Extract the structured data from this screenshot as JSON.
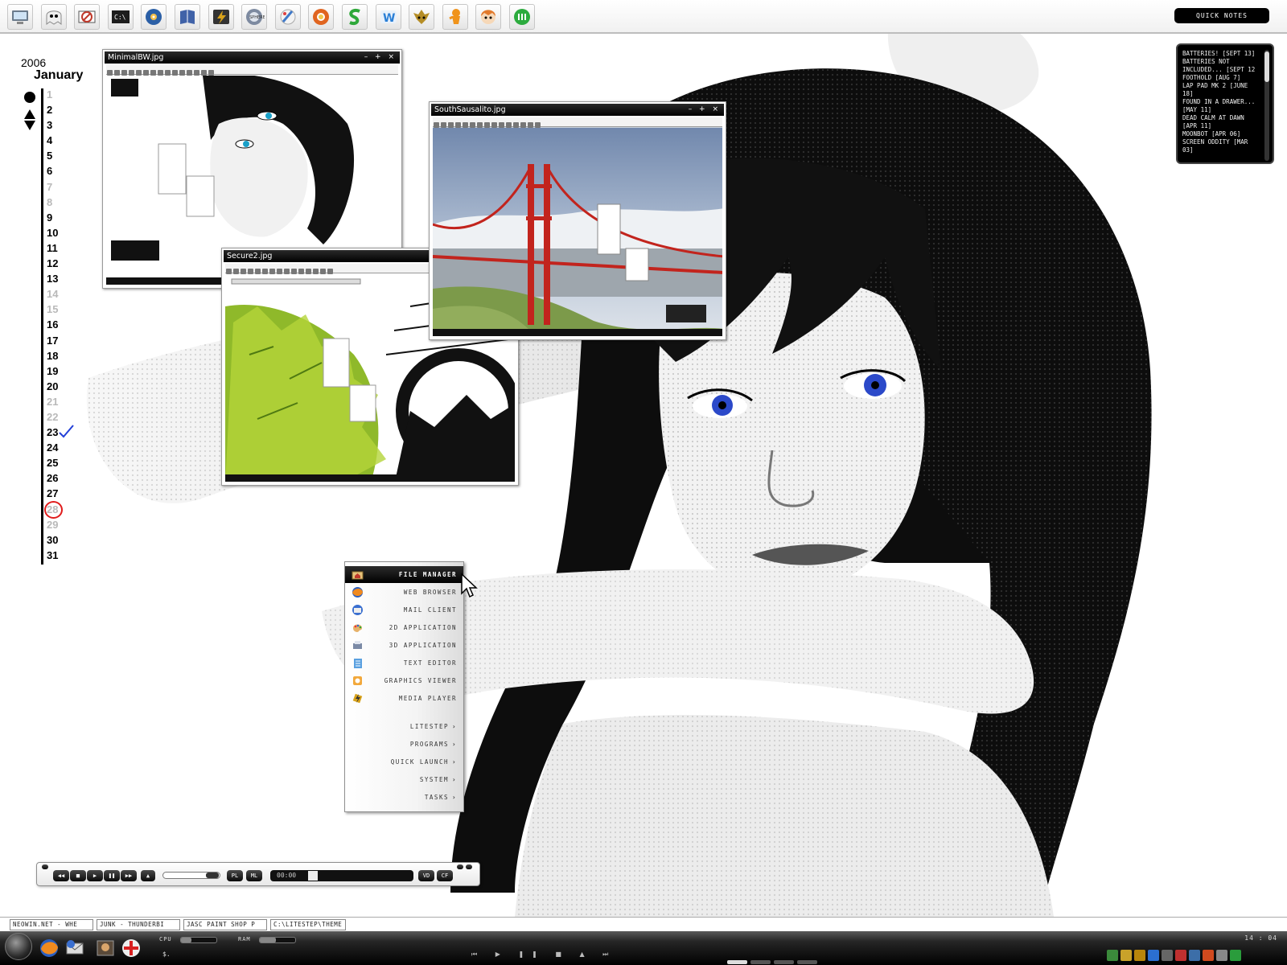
{
  "topbar": {
    "launch_icons": [
      {
        "icon": "my-computer-icon",
        "color": "#6b7b8c"
      },
      {
        "icon": "ghost-face-icon",
        "color": "#8a8a8a"
      },
      {
        "icon": "no-smoking-sign-icon",
        "color": "#c0392b"
      },
      {
        "icon": "command-prompt-icon",
        "color": "#1c1c1c"
      },
      {
        "icon": "media-disc-icon",
        "color": "#2b5fa6"
      },
      {
        "icon": "book-icon",
        "color": "#4062a8"
      },
      {
        "icon": "lightning-icon",
        "color": "#d8a21a"
      },
      {
        "icon": "chrome-sphere-icon",
        "color": "#7d8aa0"
      },
      {
        "icon": "paint-brush-icon",
        "color": "#3f79c9"
      },
      {
        "icon": "life-ring-icon",
        "color": "#e06520"
      },
      {
        "icon": "green-s-icon",
        "color": "#2ea83a"
      },
      {
        "icon": "w-letter-icon",
        "color": "#2a7fd6"
      },
      {
        "icon": "goblin-head-icon",
        "color": "#b58d25"
      },
      {
        "icon": "orange-figure-icon",
        "color": "#f0941c"
      },
      {
        "icon": "cartoon-face-icon",
        "color": "#e27a2c"
      },
      {
        "icon": "green-orb-icon",
        "color": "#2cab3e"
      }
    ],
    "quick_notes_label": "QUICK NOTES"
  },
  "notes": [
    "BATTERIES! [SEPT 13]",
    "BATTERIES NOT INCLUDED... [SEPT 12",
    "FOOTHOLD [AUG 7]",
    "LAP PAD MK 2 [JUNE 18]",
    "FOUND IN A DRAWER... [MAY 11]",
    "DEAD CALM AT DAWN [APR 11]",
    "MOONBOT [APR 06]",
    "SCREEN ODDITY [MAR 03]"
  ],
  "calendar": {
    "year": "2006",
    "month": "January",
    "days": [
      {
        "n": "1",
        "dim": true
      },
      {
        "n": "2"
      },
      {
        "n": "3"
      },
      {
        "n": "4"
      },
      {
        "n": "5"
      },
      {
        "n": "6"
      },
      {
        "n": "7",
        "dim": true
      },
      {
        "n": "8",
        "dim": true
      },
      {
        "n": "9"
      },
      {
        "n": "10"
      },
      {
        "n": "11"
      },
      {
        "n": "12"
      },
      {
        "n": "13"
      },
      {
        "n": "14",
        "dim": true
      },
      {
        "n": "15",
        "dim": true
      },
      {
        "n": "16"
      },
      {
        "n": "17"
      },
      {
        "n": "18"
      },
      {
        "n": "19"
      },
      {
        "n": "20"
      },
      {
        "n": "21",
        "dim": true
      },
      {
        "n": "22",
        "dim": true
      },
      {
        "n": "23",
        "mark": "check"
      },
      {
        "n": "24"
      },
      {
        "n": "25"
      },
      {
        "n": "26"
      },
      {
        "n": "27"
      },
      {
        "n": "28",
        "dim": true,
        "mark": "circle"
      },
      {
        "n": "29",
        "dim": true
      },
      {
        "n": "30"
      },
      {
        "n": "31"
      }
    ],
    "check_color": "#2340d8",
    "circle_color": "#e01c1c"
  },
  "windows": {
    "minimal": {
      "title": "MinimalBW.jpg"
    },
    "secure": {
      "title": "Secure2.jpg"
    },
    "sausalito": {
      "title": "SouthSausalito.jpg"
    }
  },
  "start_menu": {
    "items": [
      {
        "label": "FILE MANAGER",
        "icon": "folder-home-icon",
        "selected": true
      },
      {
        "label": "WEB BROWSER",
        "icon": "firefox-icon"
      },
      {
        "label": "MAIL CLIENT",
        "icon": "thunderbird-icon"
      },
      {
        "label": "2D APPLICATION",
        "icon": "paint-palette-icon"
      },
      {
        "label": "3D APPLICATION",
        "icon": "3d-printer-icon"
      },
      {
        "label": "TEXT EDITOR",
        "icon": "notepad-icon"
      },
      {
        "label": "GRAPHICS VIEWER",
        "icon": "image-viewer-icon"
      },
      {
        "label": "MEDIA PLAYER",
        "icon": "lightning-icon"
      },
      {
        "label": "LITESTEP",
        "submenu": true
      },
      {
        "label": "PROGRAMS",
        "submenu": true
      },
      {
        "label": "QUICK LAUNCH",
        "submenu": true
      },
      {
        "label": "SYSTEM",
        "submenu": true
      },
      {
        "label": "TASKS",
        "submenu": true
      }
    ]
  },
  "player": {
    "prev": "◀◀",
    "stop": "■",
    "play": "▶",
    "pause": "❚❚",
    "next": "▶▶",
    "eject": "▲",
    "pl": "PL",
    "ml": "ML",
    "vd": "VD",
    "cf": "CF",
    "time": "00:00"
  },
  "tasks": [
    "NEOWIN.NET - WHE",
    "JUNK - THUNDERBI",
    "JASC PAINT SHOP P",
    "C:\\LITESTEP\\THEME"
  ],
  "taskbar": {
    "cpu_label": "CPU",
    "ram_label": "RAM",
    "cpu_level": 0.3,
    "ram_level": 0.45,
    "prompt": "$.",
    "media_controls": "⏮ ▶ ❚❚ ■ ▲ ⏭",
    "clock": "14 : 04"
  }
}
